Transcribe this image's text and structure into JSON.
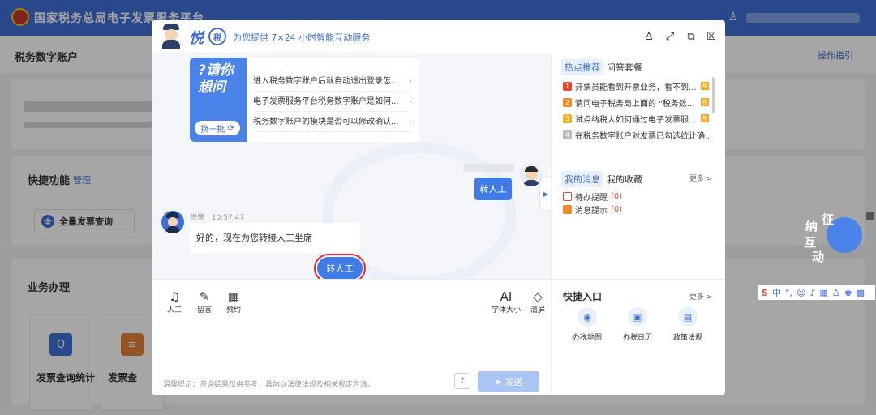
{
  "page": {
    "app_title": "国家税务总局电子发票服务平台",
    "section_title": "税务数字账户",
    "help_link": "操作指引",
    "quick_title": "快捷功能",
    "quick_manage": "管理",
    "quick_btn": "全量发票查询",
    "biz_title": "业务办理",
    "biz_cards": [
      "发票查询统计",
      "发票查"
    ]
  },
  "modal": {
    "brand": "悦",
    "brand_badge": "税",
    "subtitle": "为您提供 7×24 小时智能互动服务",
    "controls": [
      "person-icon",
      "expand-icon",
      "export-icon",
      "close-icon"
    ],
    "welcome": {
      "big_text": "?请你想问",
      "refresh": "换一批",
      "questions": [
        "进入税务数字账户后就自动退出登录怎...",
        "电子发票服务平台税务数字账户是如何...",
        "税务数字账户的模块是否可以修改确认..."
      ]
    },
    "user_msg": "转人工",
    "bot_meta": "悦悦 | 10:57:47",
    "bot_msg": "好的，现在为您转接人工坐席",
    "bot_btn": "转人工",
    "side": {
      "tabs": [
        "热点推荐",
        "问答套餐"
      ],
      "hot": [
        {
          "num": "1",
          "text": "开票员能看到开票业务，看不到...",
          "color": "#e8452c",
          "hot": true
        },
        {
          "num": "2",
          "text": "请问电子税务局上面的 \"税务数...",
          "color": "#f08a24",
          "hot": true
        },
        {
          "num": "3",
          "text": "试点纳税人如何通过电子发票服...",
          "color": "#f5b324",
          "hot": true
        },
        {
          "num": "4",
          "text": "在税务数字账户对发票已勾选统计确...",
          "color": "#b7bcc7",
          "hot": false
        }
      ],
      "msg_tabs": [
        "我的消息",
        "我的收藏"
      ],
      "more": "更多 >",
      "msgs": [
        {
          "text": "待办提醒",
          "count": "(0)",
          "color": "#e8452c"
        },
        {
          "text": "消息提示",
          "count": "(0)",
          "color": "#f08a24"
        }
      ]
    },
    "tools": [
      {
        "icon": "headset-icon",
        "glyph": "♫",
        "label": "人工"
      },
      {
        "icon": "note-icon",
        "glyph": "✎",
        "label": "留言"
      },
      {
        "icon": "calendar-icon",
        "glyph": "▦",
        "label": "预约"
      },
      {
        "icon": "font-size-icon",
        "glyph": "AI",
        "label": "字体大小"
      },
      {
        "icon": "eraser-icon",
        "glyph": "◇",
        "label": "清屏"
      }
    ],
    "disclaimer": "温馨提示：咨询结果仅供参考，具体以法律法规及相关规定为准。",
    "send": "发送",
    "quick_entry": {
      "title": "快捷入口",
      "more": "更多 >",
      "items": [
        {
          "icon": "map-pin-icon",
          "glyph": "◉",
          "label": "办税地图"
        },
        {
          "icon": "calendar-icon",
          "glyph": "▣",
          "label": "办税日历"
        },
        {
          "icon": "policy-icon",
          "glyph": "▤",
          "label": "政策法规"
        }
      ]
    }
  },
  "float_bot": [
    "征",
    "纳",
    "互",
    "动"
  ],
  "ime": [
    "S",
    "中",
    "°,",
    "☺",
    "♪",
    "▦",
    "♙",
    "♚",
    "▩"
  ]
}
